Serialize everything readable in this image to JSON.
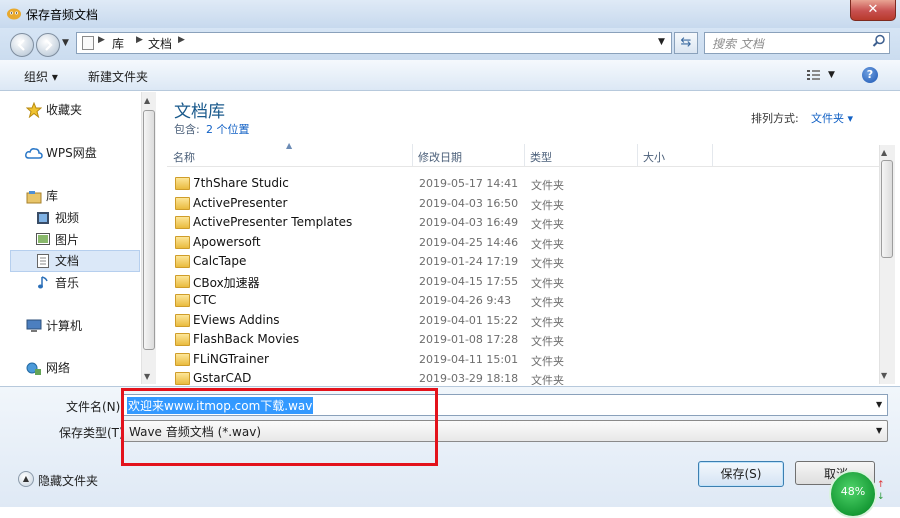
{
  "window": {
    "title": "保存音频文档",
    "close_label": "✕"
  },
  "address": {
    "lib": "库",
    "docs": "文档",
    "search_placeholder": "搜索 文档"
  },
  "toolbar": {
    "organize": "组织 ▾",
    "new_folder": "新建文件夹"
  },
  "nav": {
    "favorites": "收藏夹",
    "wps": "WPS网盘",
    "library": "库",
    "video": "视频",
    "pictures": "图片",
    "documents": "文档",
    "music": "音乐",
    "computer": "计算机",
    "network": "网络"
  },
  "library": {
    "title": "文档库",
    "includes_label": "包含:",
    "includes_link": "2 个位置",
    "arrange_label": "排列方式:",
    "arrange_value": "文件夹 ▾"
  },
  "columns": {
    "name": "名称",
    "date": "修改日期",
    "type": "类型",
    "size": "大小"
  },
  "files": [
    {
      "name": "7thShare Studic",
      "date": "2019-05-17 14:41",
      "type": "文件夹"
    },
    {
      "name": "ActivePresenter",
      "date": "2019-04-03 16:50",
      "type": "文件夹"
    },
    {
      "name": "ActivePresenter Templates",
      "date": "2019-04-03 16:49",
      "type": "文件夹"
    },
    {
      "name": "Apowersoft",
      "date": "2019-04-25 14:46",
      "type": "文件夹"
    },
    {
      "name": "CalcTape",
      "date": "2019-01-24 17:19",
      "type": "文件夹"
    },
    {
      "name": "CBox加速器",
      "date": "2019-04-15 17:55",
      "type": "文件夹"
    },
    {
      "name": "CTC",
      "date": "2019-04-26 9:43",
      "type": "文件夹"
    },
    {
      "name": "EViews Addins",
      "date": "2019-04-01 15:22",
      "type": "文件夹"
    },
    {
      "name": "FlashBack Movies",
      "date": "2019-01-08 17:28",
      "type": "文件夹"
    },
    {
      "name": "FLiNGTrainer",
      "date": "2019-04-11 15:01",
      "type": "文件夹"
    },
    {
      "name": "GstarCAD",
      "date": "2019-03-29 18:18",
      "type": "文件夹"
    }
  ],
  "form": {
    "filename_label": "文件名(N):",
    "filename_value": "欢迎来www.itmop.com下载.wav",
    "filetype_label": "保存类型(T):",
    "filetype_value": "Wave 音频文档 (*.wav)"
  },
  "footer": {
    "hide_folders": "隐藏文件夹",
    "save": "保存(S)",
    "cancel": "取消",
    "gauge": "48%"
  },
  "colors": {
    "highlight": "#e3121b",
    "selection": "#3399ff",
    "gauge": "#169a35"
  }
}
